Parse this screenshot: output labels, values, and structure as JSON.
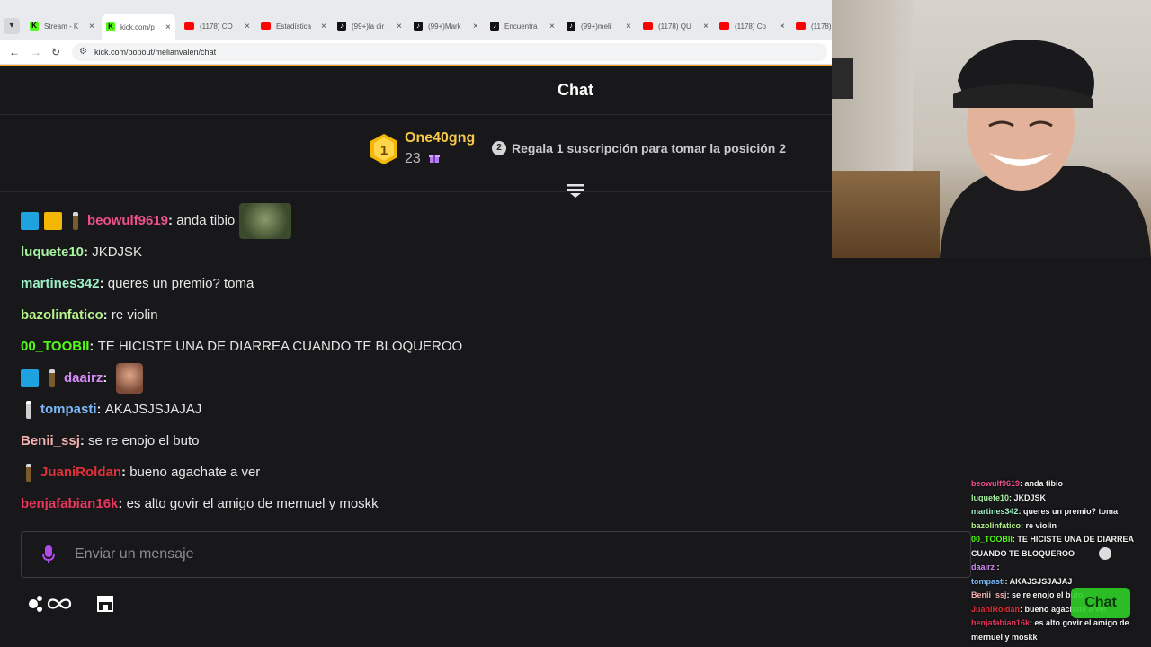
{
  "browser": {
    "tabs": [
      {
        "title": "Stream - K",
        "favicon": "kick-icon",
        "active": false
      },
      {
        "title": "kick.com/p",
        "favicon": "kick-icon",
        "active": true
      },
      {
        "title": "(1178) CO",
        "favicon": "youtube-icon",
        "active": false
      },
      {
        "title": "Estadística",
        "favicon": "youtube-icon",
        "active": false
      },
      {
        "title": "(99+)la dir",
        "favicon": "tiktok-icon",
        "active": false
      },
      {
        "title": "(99+)Mark",
        "favicon": "tiktok-icon",
        "active": false
      },
      {
        "title": "Encuentra",
        "favicon": "tiktok-icon",
        "active": false
      },
      {
        "title": "(99+)meli",
        "favicon": "tiktok-icon",
        "active": false
      },
      {
        "title": "(1178) QU",
        "favicon": "youtube-icon",
        "active": false
      },
      {
        "title": "(1178) Co",
        "favicon": "youtube-icon",
        "active": false
      },
      {
        "title": "(1178)",
        "favicon": "youtube-icon",
        "active": false
      }
    ],
    "url": "kick.com/popout/melianvalen/chat"
  },
  "chat": {
    "title": "Chat",
    "leaderboard": {
      "rank": "1",
      "name": "One40gng",
      "count": "23",
      "position_badge": "2",
      "prompt": "Regala 1 suscripción para tomar la posición 2"
    },
    "messages": [
      {
        "user": "beowulf9619",
        "color": "#f2508a",
        "text": "anda tibio",
        "badges": [
          "mod",
          "crown",
          "bottle"
        ],
        "emote": "frog"
      },
      {
        "user": "luquete10",
        "color": "#a7f3a0",
        "text": "JKDJSK",
        "badges": []
      },
      {
        "user": "martines342",
        "color": "#9ef0c7",
        "text": "queres un premio? toma",
        "badges": []
      },
      {
        "user": "bazolinfatico",
        "color": "#b6f28a",
        "text": "re violin",
        "badges": []
      },
      {
        "user": "00_TOOBII",
        "color": "#53fc18",
        "text": "TE HICISTE UNA DE DIARREA CUANDO TE BLOQUEROO",
        "badges": []
      },
      {
        "user": "daairz",
        "color": "#d18cf5",
        "text": "",
        "badges": [
          "mod",
          "bottle"
        ],
        "emote": "face"
      },
      {
        "user": "tompasti",
        "color": "#7cb7f7",
        "text": "AKAJSJSJAJAJ",
        "badges": [
          "bottle-white"
        ]
      },
      {
        "user": "Benii_ssj",
        "color": "#f5b0b0",
        "text": "se re enojo el buto",
        "badges": []
      },
      {
        "user": "JuaniRoldan",
        "color": "#e0303a",
        "text": "bueno agachate a ver",
        "badges": [
          "bottle"
        ]
      },
      {
        "user": "benjafabian16k",
        "color": "#e8365c",
        "text": "es alto govir el amigo de mernuel y moskk",
        "badges": []
      }
    ],
    "input_placeholder": "Enviar un mensaje"
  },
  "overlay": {
    "lines": [
      {
        "user": "beowulf9619",
        "color": "#f2508a",
        "text": ": anda tibio"
      },
      {
        "user": "luquete10",
        "color": "#a7f3a0",
        "text": ": JKDJSK"
      },
      {
        "user": "martines342",
        "color": "#9ef0c7",
        "text": ": queres un premio? toma"
      },
      {
        "user": "bazolinfatico",
        "color": "#b6f28a",
        "text": ": re violin"
      },
      {
        "user": "00_TOOBII",
        "color": "#53fc18",
        "text": ": TE HICISTE UNA DE DIARREA"
      },
      {
        "user": "",
        "color": "#ffffff",
        "text": "CUANDO TE BLOQUEROO"
      },
      {
        "user": "daairz",
        "color": "#d18cf5",
        "text": " :"
      },
      {
        "user": "tompasti",
        "color": "#7cb7f7",
        "text": ": AKAJSJSJAJAJ"
      },
      {
        "user": "Benii_ssj",
        "color": "#f5b0b0",
        "text": ": se re enojo el buto"
      },
      {
        "user": "JuaniRoldan",
        "color": "#e0303a",
        "text": ": bueno agachate a ver"
      },
      {
        "user": "benjafabian16k",
        "color": "#e8365c",
        "text": ": es alto govir el amigo de"
      },
      {
        "user": "",
        "color": "#ffffff",
        "text": "mernuel y moskk"
      }
    ],
    "chat_button": "Chat"
  }
}
